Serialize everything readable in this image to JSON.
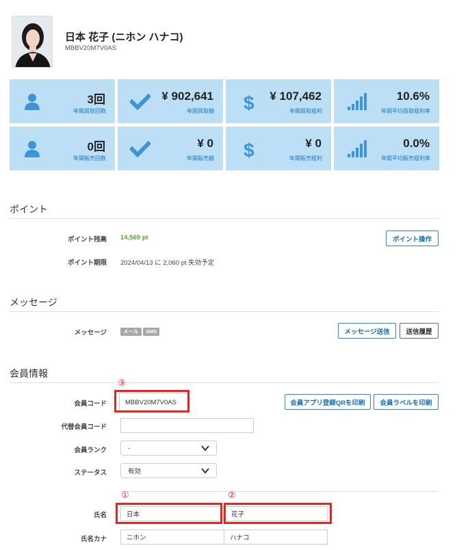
{
  "header": {
    "name": "日本 花子 (ニホン ハナコ)",
    "member_code": "MBBV20M7V0AS"
  },
  "stats": [
    {
      "icon": "person-icon",
      "value": "3回",
      "label": "年間買取回数"
    },
    {
      "icon": "check-icon",
      "value": "¥ 902,641",
      "label": "年間買取額"
    },
    {
      "icon": "dollar-icon",
      "value": "¥ 107,462",
      "label": "年間買取粗利"
    },
    {
      "icon": "bar-chart-icon",
      "value": "10.6%",
      "label": "年間平均買取粗利率"
    },
    {
      "icon": "person-icon",
      "value": "0回",
      "label": "年間販売回数"
    },
    {
      "icon": "check-icon",
      "value": "¥ 0",
      "label": "年間販売額"
    },
    {
      "icon": "dollar-icon",
      "value": "¥ 0",
      "label": "年間販売粗利"
    },
    {
      "icon": "bar-chart-icon",
      "value": "0.0%",
      "label": "年間平均販売粗利率"
    }
  ],
  "points": {
    "title": "ポイント",
    "balance_label": "ポイント残高",
    "balance_value": "14,569 pt",
    "operate_button": "ポイント操作",
    "expiry_label": "ポイント期限",
    "expiry_value": "2024/04/13 に 2,060 pt 失効予定"
  },
  "message": {
    "title": "メッセージ",
    "label": "メッセージ",
    "badge_mail": "メール",
    "badge_sms": "SMS",
    "send_button": "メッセージ送信",
    "history_button": "送信履歴"
  },
  "member": {
    "title": "会員情報",
    "code_label": "会員コード",
    "code_value": "MBBV20M7V0AS",
    "qr_button": "会員アプリ登録QRを印刷",
    "print_label_button": "会員ラベルを印刷",
    "alt_code_label": "代替会員コード",
    "alt_code_value": "",
    "rank_label": "会員ランク",
    "rank_value": "-",
    "status_label": "ステータス",
    "status_value": "有効",
    "name_label": "氏名",
    "last_name": "日本",
    "first_name": "花子",
    "kana_label": "氏名カナ",
    "last_kana": "ニホン",
    "first_kana": "ハナコ"
  },
  "annotations": {
    "marker1": "①",
    "marker2": "②",
    "marker3": "③",
    "highlight_color": "#e3261f"
  }
}
